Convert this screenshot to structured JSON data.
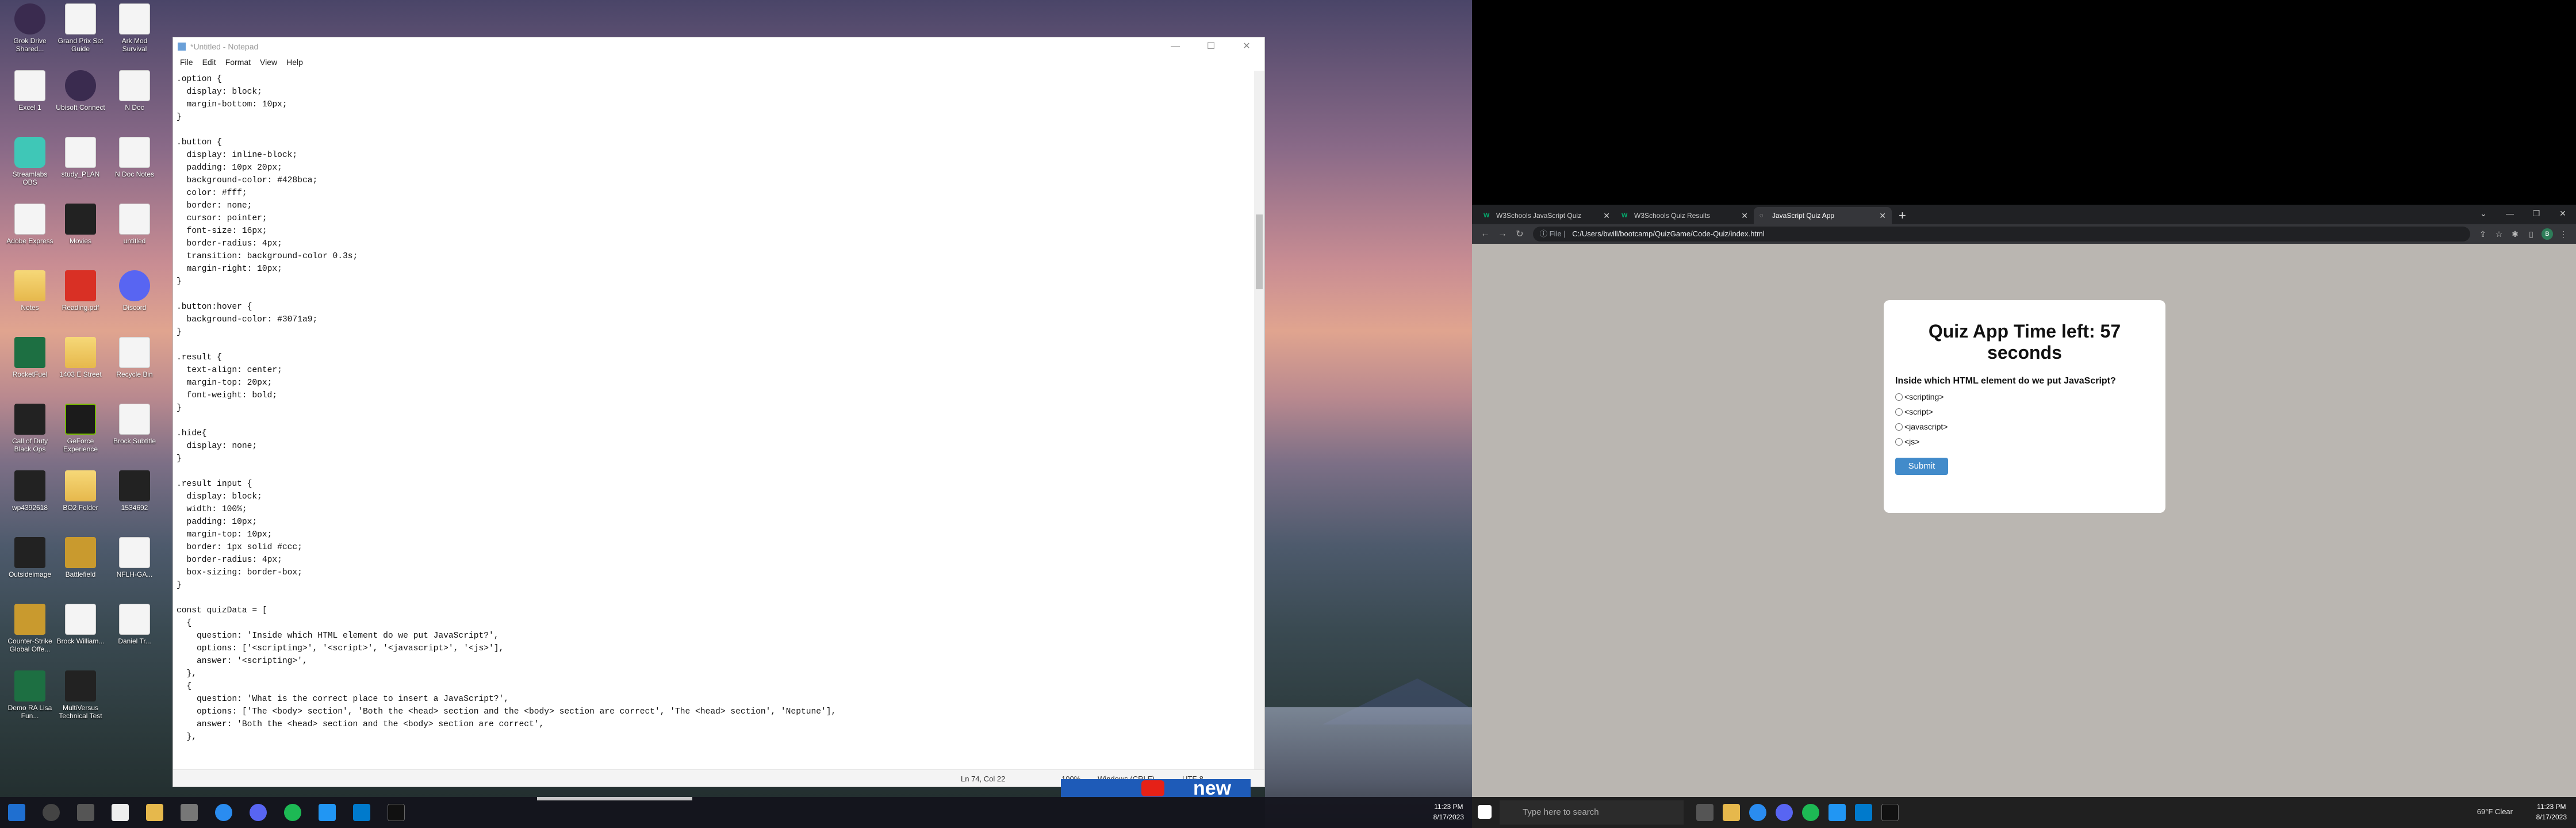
{
  "desktop": {
    "icons": [
      {
        "label": "Grok Drive Shared...",
        "kind": "round"
      },
      {
        "label": "Grand Prix Set Guide",
        "kind": "file"
      },
      {
        "label": "Ark Mod Survival",
        "kind": "file"
      },
      {
        "label": "Excel 1",
        "kind": "file"
      },
      {
        "label": "Ubisoft Connect",
        "kind": "round"
      },
      {
        "label": "N Doc",
        "kind": "file"
      },
      {
        "label": "Streamlabs OBS",
        "kind": "teal"
      },
      {
        "label": "study_PLAN",
        "kind": "file"
      },
      {
        "label": "N Doc Notes",
        "kind": "file"
      },
      {
        "label": "Adobe Express",
        "kind": "file"
      },
      {
        "label": "Movies",
        "kind": "dark"
      },
      {
        "label": "untitled",
        "kind": "file"
      },
      {
        "label": "Notes",
        "kind": "folder"
      },
      {
        "label": "Reading.pdf",
        "kind": "pdf"
      },
      {
        "label": "Discord",
        "kind": "discord"
      },
      {
        "label": "RocketFuel",
        "kind": "excel"
      },
      {
        "label": "1403 E Street",
        "kind": "folder"
      },
      {
        "label": "Recycle Bin",
        "kind": "file"
      },
      {
        "label": "Call of Duty Black Ops",
        "kind": "dark"
      },
      {
        "label": "GeForce Experience",
        "kind": "nvidia"
      },
      {
        "label": "Brock Subtitle",
        "kind": "file"
      },
      {
        "label": "wp4392618",
        "kind": "dark"
      },
      {
        "label": "BO2 Folder",
        "kind": "folder"
      },
      {
        "label": "1534692",
        "kind": "dark"
      },
      {
        "label": "Outsideimage",
        "kind": "dark"
      },
      {
        "label": "Battlefield",
        "kind": "gold"
      },
      {
        "label": "NFLH-GA...",
        "kind": "file"
      },
      {
        "label": "Counter-Strike Global Offe...",
        "kind": "gold"
      },
      {
        "label": "Brock William...",
        "kind": "file"
      },
      {
        "label": "Daniel Tr...",
        "kind": "file"
      },
      {
        "label": "Demo RA Lisa Fun...",
        "kind": "excel"
      },
      {
        "label": "MultiVersus Technical Test",
        "kind": "dark"
      }
    ]
  },
  "notepad": {
    "title": "*Untitled - Notepad",
    "menu": [
      "File",
      "Edit",
      "Format",
      "View",
      "Help"
    ],
    "content": ".option {\n  display: block;\n  margin-bottom: 10px;\n}\n\n.button {\n  display: inline-block;\n  padding: 10px 20px;\n  background-color: #428bca;\n  color: #fff;\n  border: none;\n  cursor: pointer;\n  font-size: 16px;\n  border-radius: 4px;\n  transition: background-color 0.3s;\n  margin-right: 10px;\n}\n\n.button:hover {\n  background-color: #3071a9;\n}\n\n.result {\n  text-align: center;\n  margin-top: 20px;\n  font-weight: bold;\n}\n\n.hide{\n  display: none;\n}\n\n.result input {\n  display: block;\n  width: 100%;\n  padding: 10px;\n  margin-top: 10px;\n  border: 1px solid #ccc;\n  border-radius: 4px;\n  box-sizing: border-box;\n}\n\nconst quizData = [\n  {\n    question: 'Inside which HTML element do we put JavaScript?',\n    options: ['<scripting>', '<script>', '<javascript>', '<js>'],\n    answer: '<scripting>',\n  },\n  {\n    question: 'What is the correct place to insert a JavaScript?',\n    options: ['The <body> section', 'Both the <head> section and the <body> section are correct', 'The <head> section', 'Neptune'],\n    answer: 'Both the <head> section and the <body> section are correct',\n  },",
    "status": {
      "position": "Ln 74, Col 22",
      "zoom": "100%",
      "line_endings": "Windows (CRLF)",
      "encoding": "UTF-8"
    }
  },
  "taskbar_left": {
    "time": "11:23 PM",
    "date": "8/17/2023"
  },
  "youtube_banner": "new",
  "browser": {
    "tabs": [
      {
        "label": "W3Schools JavaScript Quiz",
        "favicon": "W"
      },
      {
        "label": "W3Schools Quiz Results",
        "favicon": "W"
      },
      {
        "label": "JavaScript Quiz App",
        "favicon": ""
      }
    ],
    "address": {
      "chip": "File",
      "url": "C:/Users/bwill/bootcamp/QuizGame/Code-Quiz/index.html"
    },
    "quiz": {
      "title": "Quiz App Time left: 57 seconds",
      "question": "Inside which HTML element do we put JavaScript?",
      "options": [
        "<scripting>",
        "<script>",
        "<javascript>",
        "<js>"
      ],
      "submit_label": "Submit",
      "accent": "#428bca"
    }
  },
  "taskbar_right": {
    "search_placeholder": "Type here to search",
    "weather": "69°F  Clear",
    "time": "11:23 PM",
    "date": "8/17/2023"
  }
}
